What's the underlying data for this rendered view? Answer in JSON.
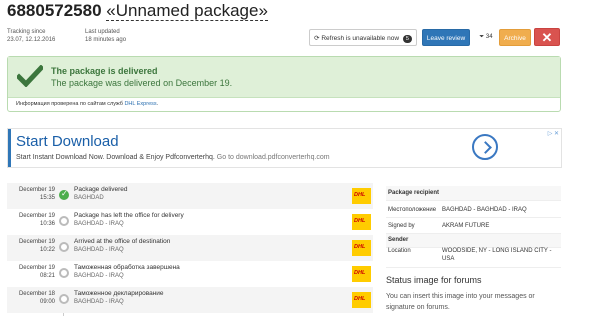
{
  "header": {
    "tracking_number": "6880572580",
    "package_name": "«Unnamed package»",
    "tracking_since_label": "Tracking since",
    "tracking_since_value": "23.07, 12.12.2016",
    "last_updated_label": "Last updated",
    "last_updated_value": "18 minutes ago"
  },
  "toolbar": {
    "refresh_label": "Refresh is unavailable now",
    "refresh_badge": "5",
    "review_label": "Leave review",
    "count_label": "34",
    "archive_label": "Archive",
    "delete_label": "✕"
  },
  "status": {
    "title": "The package is delivered",
    "subtitle": "The package was delivered on December 19.",
    "info_prefix": "Информация проверена по сайтам служб",
    "info_link": "DHL Express",
    "color": "#3c763d"
  },
  "ad": {
    "title": "Start Download",
    "description": "Start Instant Download Now. Download & Enjoy Pdfconverterhq.",
    "domain": "Go to download.pdfconverterhq.com",
    "tags": "▷ ✕"
  },
  "events": [
    {
      "date": "December 19",
      "time": "15:35",
      "title": "Package delivered",
      "location": "BAGHDAD",
      "done": true
    },
    {
      "date": "December 19",
      "time": "10:36",
      "title": "Package has left the office for delivery",
      "location": "BAGHDAD - IRAQ",
      "done": false
    },
    {
      "date": "December 19",
      "time": "10:22",
      "title": "Arrived at the office of destination",
      "location": "BAGHDAD - IRAQ",
      "done": false
    },
    {
      "date": "December 19",
      "time": "08:21",
      "title": "Таможенная обработка завершена",
      "location": "BAGHDAD - IRAQ",
      "done": false
    },
    {
      "date": "December 18",
      "time": "09:00",
      "title": "Таможенное декларирование",
      "location": "BAGHDAD - IRAQ",
      "done": false
    }
  ],
  "recipient": {
    "header": "Package recipient",
    "location_label": "Местоположение",
    "location_value": "BAGHDAD - BAGHDAD - IRAQ",
    "signed_label": "Signed by",
    "signed_value": "AKRAM FUTURE"
  },
  "sender": {
    "header": "Sender",
    "location_label": "Location",
    "location_value": "WOODSIDE, NY - LONG ISLAND CITY - USA"
  },
  "forums": {
    "title": "Status image for forums",
    "text": "You can insert this image into your messages or signature on forums."
  }
}
